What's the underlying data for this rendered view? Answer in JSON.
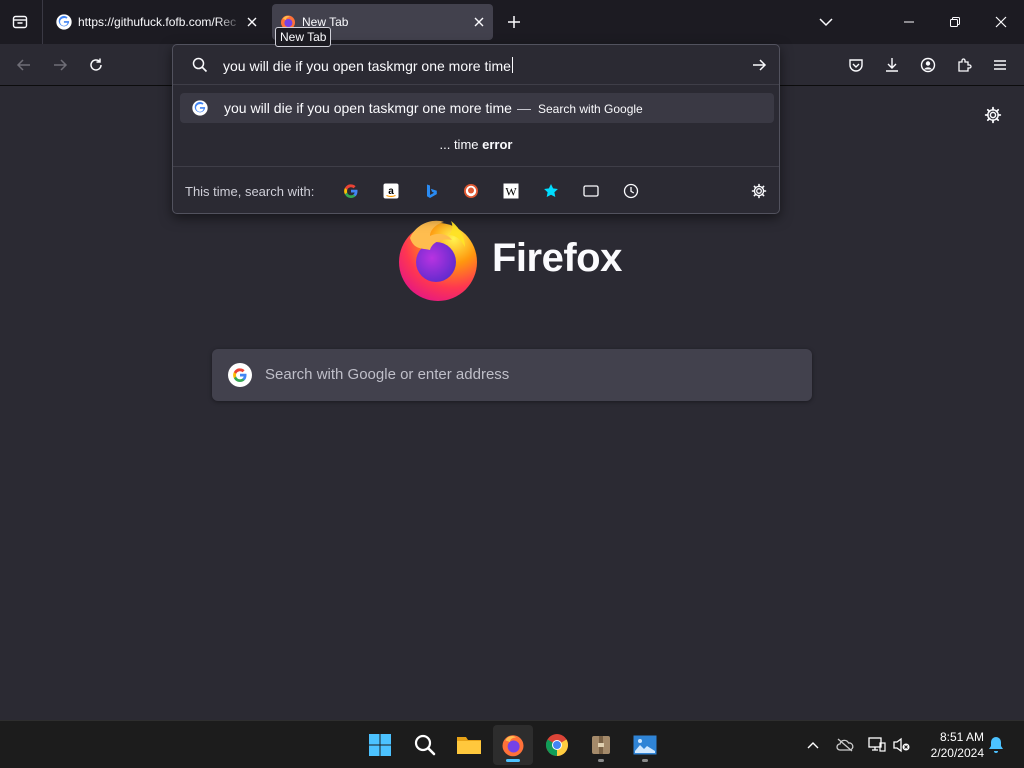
{
  "tabs": [
    {
      "title": "https://githufuck.fofb.com/Rec",
      "favicon": "google-g-icon",
      "active": false
    },
    {
      "title": "New Tab",
      "favicon": "firefox-icon",
      "active": true
    }
  ],
  "tooltip": "New Tab",
  "urlbar": {
    "value": "you will die if you open taskmgr one more time",
    "result": {
      "query": "you will die if you open taskmgr one more time",
      "separator": "—",
      "action": "Search with Google"
    },
    "suggestion_prefix": "... time ",
    "suggestion_bold": "error",
    "oneoff_label": "This time, search with:",
    "oneoffs": [
      "google",
      "amazon",
      "bing",
      "duckduckgo",
      "wikipedia",
      "bookmarks",
      "tabs",
      "history"
    ]
  },
  "ntp": {
    "brand": "Firefox",
    "search_placeholder": "Search with Google or enter address"
  },
  "taskbar": {
    "time": "8:51 AM",
    "date": "2/20/2024",
    "apps": [
      "start",
      "search",
      "file-explorer",
      "firefox",
      "chrome",
      "archive",
      "paint"
    ]
  },
  "colors": {
    "background": "#2b2a33",
    "toolbar": "#2b2a33",
    "tabstrip": "#1c1b22",
    "accent": "#4cc2ff"
  }
}
